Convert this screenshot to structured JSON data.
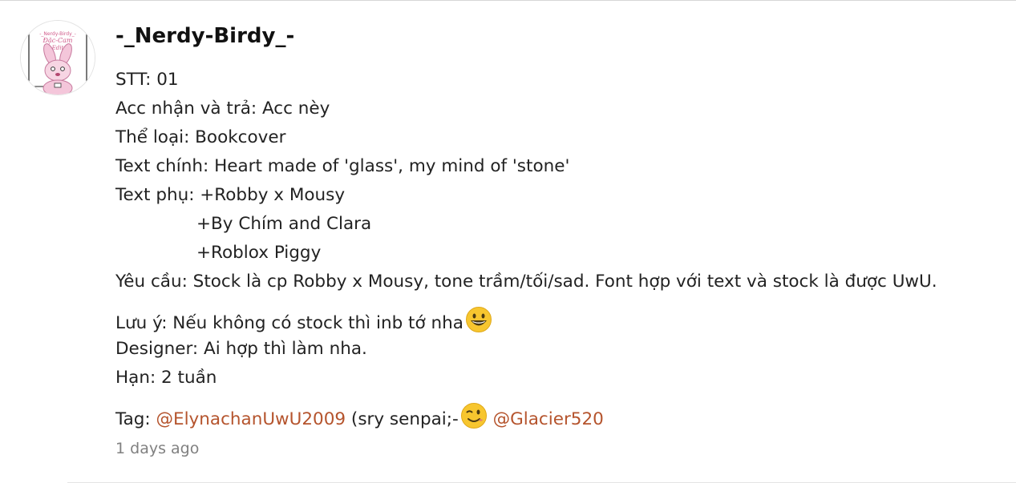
{
  "comment": {
    "author": "-_Nerdy-Birdy_-",
    "avatar": {
      "icon": "pink-bunny-avatar",
      "text_lines": [
        "-_Nerdy-Birdy_-",
        "Đặc-Cam",
        "Edit"
      ]
    },
    "lines": {
      "stt": "STT: 01",
      "acc": "Acc nhận và trả: Acc nèy",
      "genre": "Thể loại: Bookcover",
      "main_text": "Text chính: Heart made of 'glass', my mind of 'stone'",
      "sub_text_1": "Text phụ: +Robby x Mousy",
      "sub_text_2": "+By Chím and Clara",
      "sub_text_3": "+Roblox Piggy",
      "request": "Yêu cầu: Stock là cp Robby x Mousy, tone trầm/tối/sad. Font hợp với text và stock là được UwU.",
      "note": "Lưu ý: Nếu không có stock thì inb tớ nha",
      "designer": "Designer: Ai hợp thì làm nha.",
      "deadline": "Hạn: 2 tuần",
      "tag_prefix": "Tag: ",
      "mention_1": "@ElynachanUwU2009",
      "tag_middle": " (sry senpai;-",
      "mention_2": "@Glacier520"
    },
    "emojis": {
      "note_emoji": "grinning-face-emoji",
      "tag_emoji": "winking-face-emoji"
    },
    "timestamp": "1 days ago"
  },
  "colors": {
    "mention": "#b5542d",
    "timestamp": "#808080",
    "text": "#222222",
    "emoji_face": "#f7c62f"
  }
}
